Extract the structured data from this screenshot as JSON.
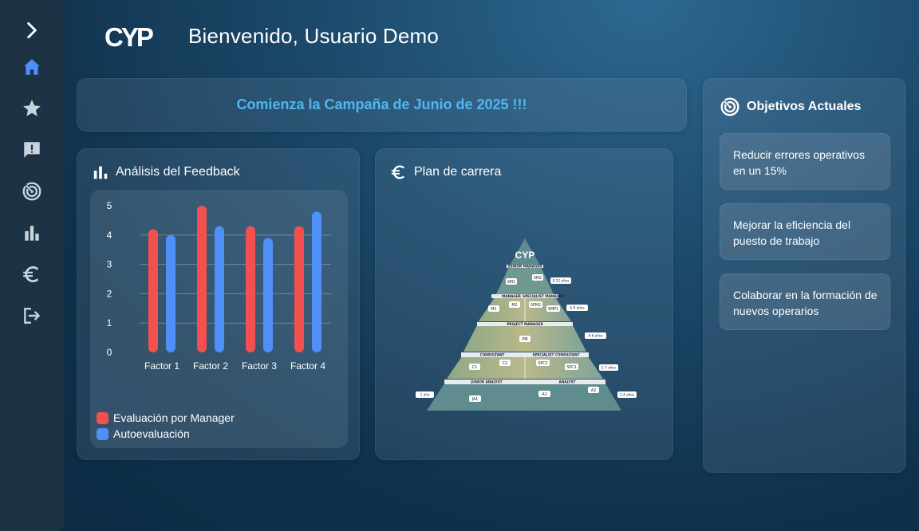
{
  "header": {
    "logo_text": "CYP",
    "welcome": "Bienvenido, Usuario Demo"
  },
  "sidebar": {
    "items": [
      {
        "icon": "chevron-right-icon"
      },
      {
        "icon": "home-icon",
        "active": true
      },
      {
        "icon": "star-icon"
      },
      {
        "icon": "feedback-icon"
      },
      {
        "icon": "target-icon"
      },
      {
        "icon": "bar-chart-icon"
      },
      {
        "icon": "euro-icon"
      },
      {
        "icon": "logout-icon"
      }
    ],
    "active_color": "#4f8ff7",
    "icon_color": "#c9d3dc"
  },
  "banner": {
    "text": "Comienza la Campaña de Junio de 2025 !!!",
    "color": "#4fb8f0"
  },
  "feedback": {
    "title": "Análisis del Feedback"
  },
  "chart_data": {
    "type": "bar",
    "categories": [
      "Factor 1",
      "Factor 2",
      "Factor 3",
      "Factor 4"
    ],
    "series": [
      {
        "name": "Evaluación por Manager",
        "values": [
          4.2,
          5.0,
          4.3,
          4.3
        ],
        "color": "#f4504f"
      },
      {
        "name": "Autoevaluación",
        "values": [
          4.0,
          4.3,
          3.9,
          4.8
        ],
        "color": "#4f8ff7"
      }
    ],
    "yticks": [
      "0",
      "1",
      "2",
      "3",
      "4",
      "5"
    ],
    "ylim": [
      0,
      5
    ],
    "grid": true,
    "legend": "bottom-left"
  },
  "career": {
    "title": "Plan de carrera",
    "pyramid": {
      "logo": "CYP",
      "levels": [
        {
          "labels": [
            "SENIOR MANAGER"
          ],
          "boxes": [
            "SM1",
            "SM2"
          ],
          "years": "9-12 años"
        },
        {
          "labels": [
            "MANAGER",
            "SPECIALIST MANAGER"
          ],
          "boxes": [
            "M1",
            "M2",
            "SPM2",
            "SMP1"
          ],
          "years": "6-9 años"
        },
        {
          "labels": [
            "PROJECT MANAGER"
          ],
          "boxes": [
            "PM"
          ],
          "years": "4-6 años"
        },
        {
          "labels": [
            "CONSULTANT",
            "SPECIALIST CONSULTANT"
          ],
          "boxes": [
            "C1",
            "C2",
            "SPC2",
            "SPC1"
          ],
          "years": "2-7 años"
        },
        {
          "labels": [
            "JUNIOR ANALYST",
            "ANALYST"
          ],
          "boxes": [
            "JA1",
            "A1",
            "A2"
          ],
          "years": "1-4 años",
          "left_years": "1 año"
        }
      ]
    }
  },
  "objectives": {
    "title": "Objetivos Actuales",
    "items": [
      "Reducir errores operativos en un 15%",
      "Mejorar la eficiencia del puesto de trabajo",
      "Colaborar en la formación de nuevos operarios"
    ]
  }
}
